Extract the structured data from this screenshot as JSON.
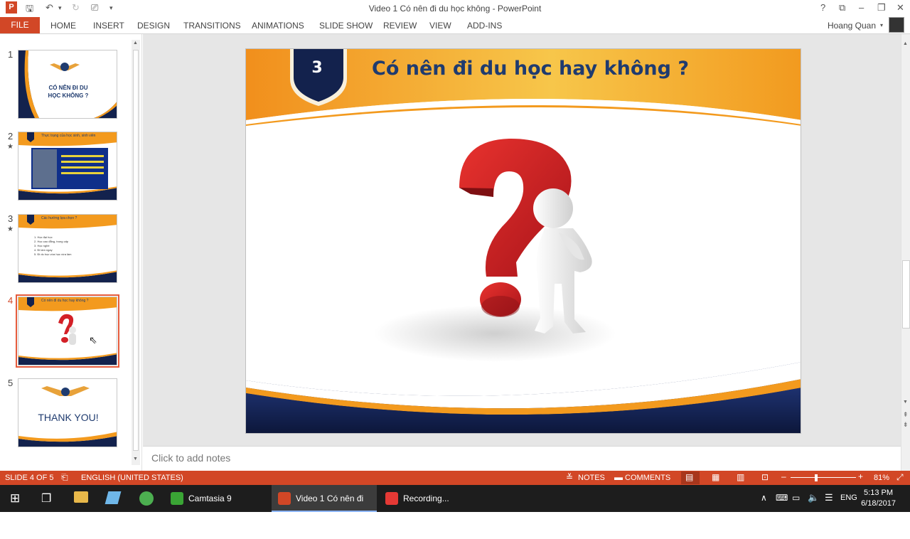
{
  "window": {
    "title": "Video 1 Có nên đi du học không - PowerPoint",
    "help": "?",
    "controls": [
      "?",
      "⧉",
      "–",
      "❐",
      "✕"
    ]
  },
  "ribbon": {
    "file": "FILE",
    "tabs": [
      "HOME",
      "INSERT",
      "DESIGN",
      "TRANSITIONS",
      "ANIMATIONS",
      "SLIDE SHOW",
      "REVIEW",
      "VIEW",
      "ADD-INS"
    ],
    "user": "Hoang Quan"
  },
  "thumbnails": [
    {
      "num": "1",
      "star": "",
      "title": "CÓ NÊN ĐI DU HỌC KHÔNG ?"
    },
    {
      "num": "2",
      "star": "★",
      "title": "Thực trạng của học sinh, sinh viên"
    },
    {
      "num": "3",
      "star": "★",
      "title": "Các hướng lựa chọn ?",
      "items": [
        "1. Học đại học",
        "2. Học cao đẳng, trung cấp",
        "3. Học nghề",
        "4. Đi làm ngay",
        "5. Đi du học vừa học vừa làm"
      ]
    },
    {
      "num": "4",
      "star": "",
      "title": "Có nên đi du học hay không ?"
    },
    {
      "num": "5",
      "star": "",
      "title": "THANK YOU!"
    }
  ],
  "slide": {
    "number": "3",
    "title": "Có nên đi du học hay không ?"
  },
  "notes": {
    "placeholder": "Click to add notes"
  },
  "status": {
    "slide": "SLIDE 4 OF 5",
    "language": "ENGLISH (UNITED STATES)",
    "notes": "NOTES",
    "comments": "COMMENTS",
    "zoom": "81%"
  },
  "taskbar": {
    "apps": [
      "Camtasia 9",
      "Video 1 Có nên đi d...",
      "Recording..."
    ],
    "lang": "ENG",
    "time": "5:13 PM",
    "date": "6/18/2017"
  },
  "colors": {
    "accent": "#d24726",
    "slide_title": "#1f3b6f",
    "orange": "#f39a1e",
    "navy": "#13224d"
  }
}
